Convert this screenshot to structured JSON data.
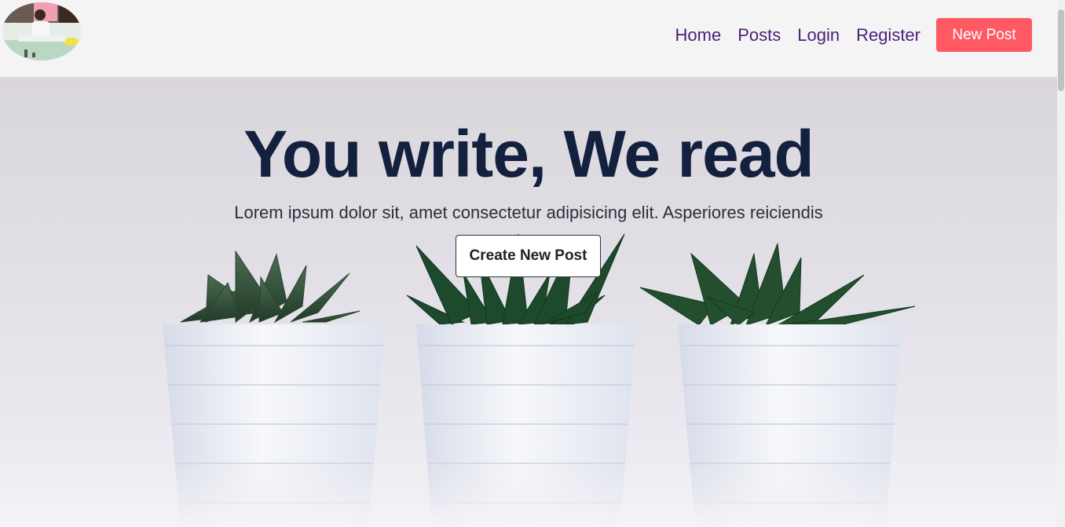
{
  "nav": {
    "links": [
      "Home",
      "Posts",
      "Login",
      "Register"
    ],
    "cta": "New Post"
  },
  "hero": {
    "title": "You write, We read",
    "subtitle": "Lorem ipsum dolor sit, amet consectetur adipisicing elit. Asperiores reiciendis",
    "button": "Create New Post"
  },
  "colors": {
    "nav_link": "#4a1f7a",
    "cta_bg": "#ff5a63",
    "title": "#13213f",
    "background": "#f4f4f4"
  },
  "icons": {
    "logo": "profile-photo-logo",
    "hero_image": "three-succulents-in-white-pots"
  }
}
